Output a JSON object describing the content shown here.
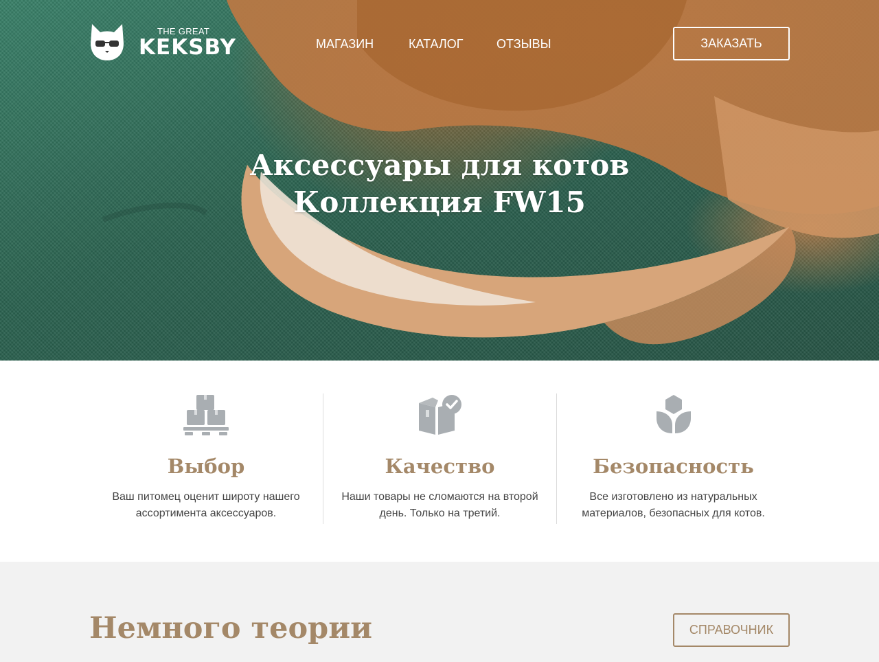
{
  "colors": {
    "accent": "#a48868",
    "hero_green": "#2f6b57",
    "hero_fur": "#c4803f",
    "icon_gray": "#a9aeb2",
    "section_bg": "#f2f2f2",
    "text": "#444444"
  },
  "header": {
    "logo_small": "THE GREAT",
    "logo_big": "KEKSBY",
    "logo_icon": "cat-with-glasses-icon",
    "nav": {
      "shop": "МАГАЗИН",
      "catalog": "КАТАЛОГ",
      "reviews": "ОТЗЫВЫ"
    },
    "order_button": "ЗАКАЗАТЬ"
  },
  "hero": {
    "title_line1": "Аксессуары для котов",
    "title_line2": "Коллекция FW15"
  },
  "features": [
    {
      "icon": "boxes-on-pallet-icon",
      "title": "Выбор",
      "text": "Ваш питомец оценит широту нашего ассортимента аксессуаров."
    },
    {
      "icon": "box-with-checkmark-icon",
      "title": "Качество",
      "text": "Наши товары не сломаются на второй день. Только на третий."
    },
    {
      "icon": "leaf-sprout-icon",
      "title": "Безопасность",
      "text": "Все изготовлено из натуральных материалов, безопасных для котов."
    }
  ],
  "theory": {
    "title": "Немного теории",
    "button": "СПРАВОЧНИК"
  }
}
